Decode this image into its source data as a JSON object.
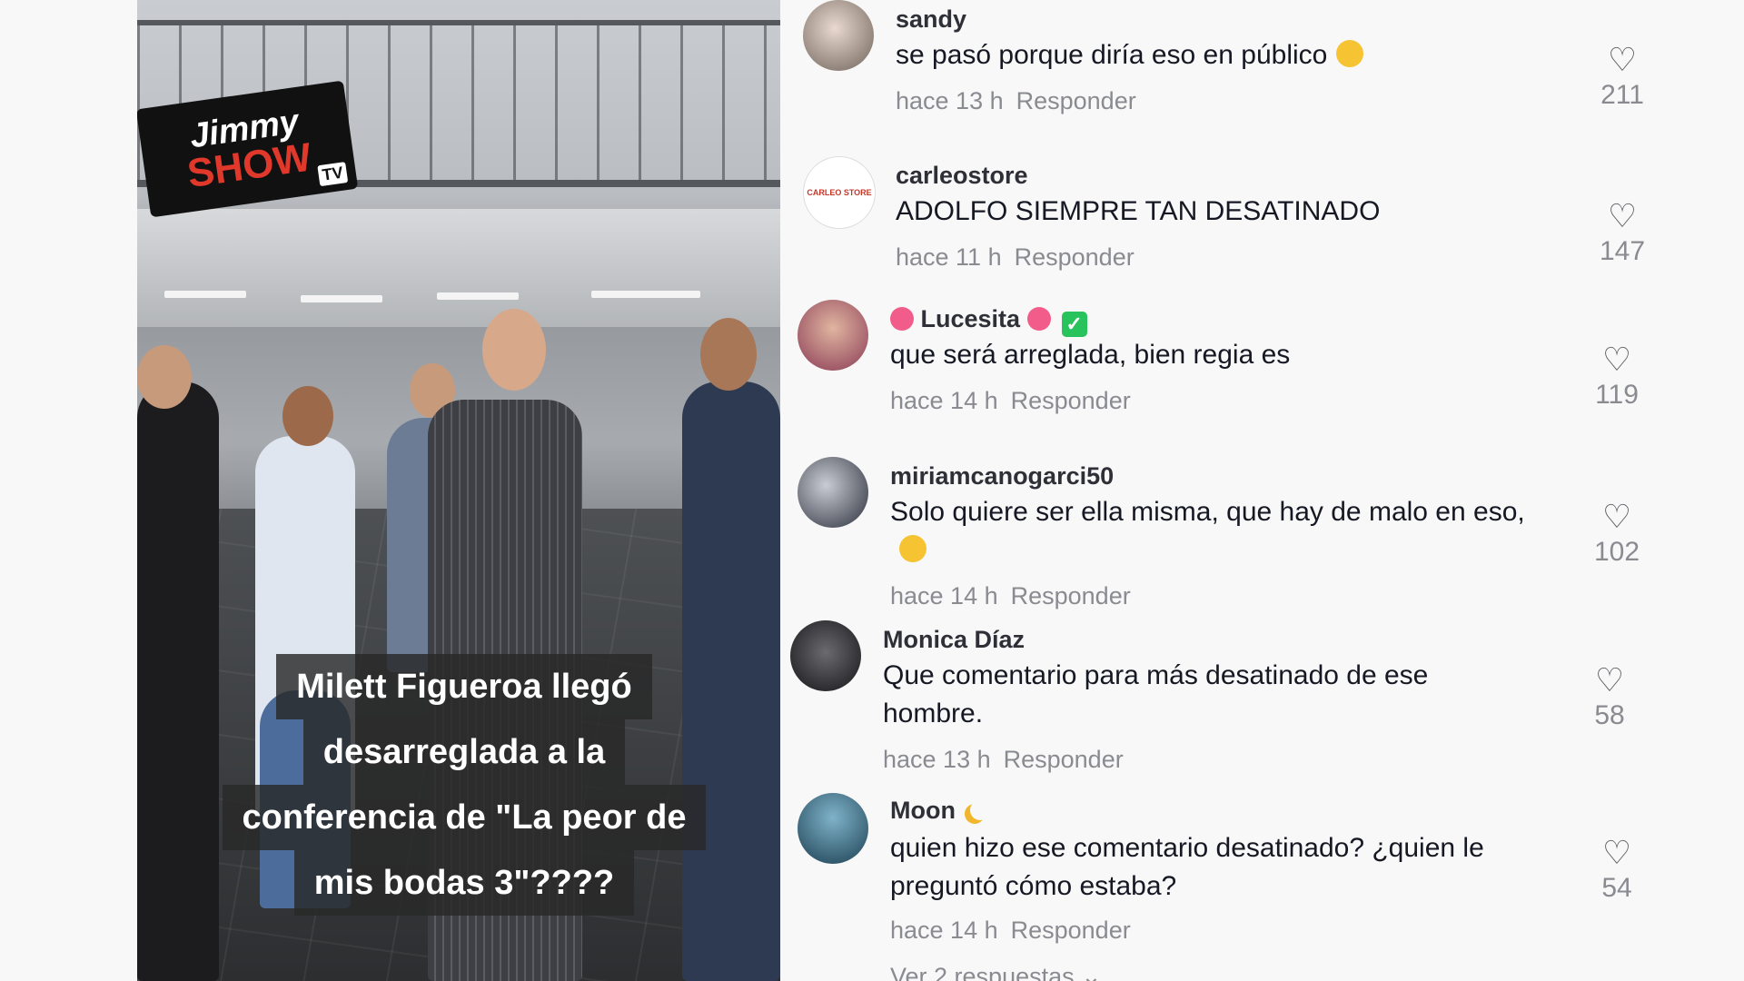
{
  "video": {
    "logo": {
      "line1": "Jimmy",
      "line2": "SHOW",
      "badge": "TV"
    },
    "caption": [
      "Milett Figueroa llegó",
      "desarreglada a la",
      "conferencia de \"La peor de",
      "mis bodas 3\"????"
    ]
  },
  "comments": [
    {
      "user": "sandy",
      "text": "se pasó porque diría eso en público",
      "emoji": "pleading-face",
      "time": "hace 13 h",
      "reply": "Responder",
      "likes": "211"
    },
    {
      "user": "carleostore",
      "text": "ADOLFO SIEMPRE TAN DESATINADO",
      "time": "hace 11 h",
      "reply": "Responder",
      "likes": "147"
    },
    {
      "user": "Lucesita",
      "text": "que será arreglada, bien regia es",
      "time": "hace 14 h",
      "reply": "Responder",
      "likes": "119",
      "decor": "flower",
      "verified": true
    },
    {
      "user": "miriamcanogarci50",
      "text": "Solo quiere ser ella misma, que hay de malo en eso,",
      "emoji": "flushed-face",
      "time": "hace 14 h",
      "reply": "Responder",
      "likes": "102"
    },
    {
      "user": "Monica Díaz",
      "text": "Que comentario para más desatinado de ese hombre.",
      "time": "hace 13 h",
      "reply": "Responder",
      "likes": "58"
    },
    {
      "user": "Moon",
      "text": "quien hizo ese comentario desatinado? ¿quien le preguntó cómo estaba?",
      "time": "hace 14 h",
      "reply": "Responder",
      "likes": "54",
      "decor": "moon"
    }
  ],
  "more_replies": "Ver 2 respuestas ⌄",
  "icons": {
    "like": "heart-outline-icon",
    "verified": "verified-check-icon"
  },
  "colors": {
    "background": "#f8f8f8",
    "text": "#161823",
    "muted": "#8a8b91",
    "verified": "#28c35c"
  }
}
